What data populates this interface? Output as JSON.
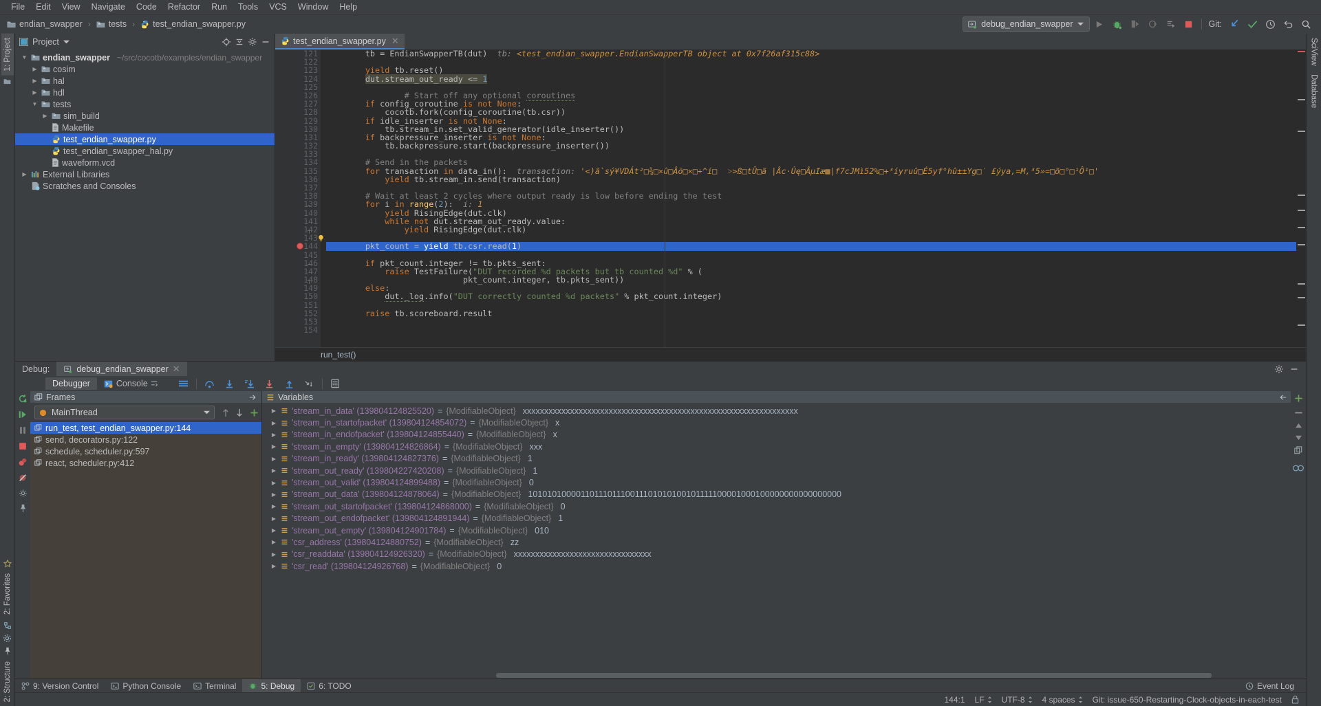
{
  "menu": {
    "items": [
      "File",
      "Edit",
      "View",
      "Navigate",
      "Code",
      "Refactor",
      "Run",
      "Tools",
      "VCS",
      "Window",
      "Help"
    ]
  },
  "breadcrumb": {
    "project": "endian_swapper",
    "folder": "tests",
    "file": "test_endian_swapper.py",
    "sep": "›"
  },
  "toolbar": {
    "run_config": "debug_endian_swapper",
    "git_label": "Git:",
    "icons": [
      "run-icon",
      "debug-icon",
      "coverage-icon",
      "profile-icon",
      "attach-icon",
      "stop-icon"
    ],
    "git_icons": [
      "update-project-icon",
      "commit-icon",
      "history-icon",
      "rollback-icon",
      "search-everywhere-icon"
    ]
  },
  "left_strip": {
    "project_tab": "1: Project",
    "favorites_tab": "2: Favorites",
    "structure_tab": "2: Structure"
  },
  "right_strip": {
    "sciview_tab": "SciView",
    "database_tab": "Database"
  },
  "project_panel": {
    "title": "Project",
    "tree": [
      {
        "depth": 0,
        "arrow": "▼",
        "icon": "folder-icon",
        "label": "endian_swapper",
        "bold": true,
        "path": "~/src/cocotb/examples/endian_swapper",
        "selected": false
      },
      {
        "depth": 1,
        "arrow": "▶",
        "icon": "folder-icon",
        "label": "cosim",
        "bold": false,
        "path": "",
        "selected": false
      },
      {
        "depth": 1,
        "arrow": "▶",
        "icon": "folder-icon",
        "label": "hal",
        "bold": false,
        "path": "",
        "selected": false
      },
      {
        "depth": 1,
        "arrow": "▶",
        "icon": "folder-icon",
        "label": "hdl",
        "bold": false,
        "path": "",
        "selected": false
      },
      {
        "depth": 1,
        "arrow": "▼",
        "icon": "folder-icon",
        "label": "tests",
        "bold": false,
        "path": "",
        "selected": false
      },
      {
        "depth": 2,
        "arrow": "▶",
        "icon": "folder-icon",
        "label": "sim_build",
        "bold": false,
        "path": "",
        "selected": false
      },
      {
        "depth": 2,
        "arrow": "",
        "icon": "file-icon",
        "label": "Makefile",
        "bold": false,
        "path": "",
        "selected": false
      },
      {
        "depth": 2,
        "arrow": "",
        "icon": "python-icon",
        "label": "test_endian_swapper.py",
        "bold": false,
        "path": "",
        "selected": true
      },
      {
        "depth": 2,
        "arrow": "",
        "icon": "python-icon",
        "label": "test_endian_swapper_hal.py",
        "bold": false,
        "path": "",
        "selected": false
      },
      {
        "depth": 2,
        "arrow": "",
        "icon": "file-icon",
        "label": "waveform.vcd",
        "bold": false,
        "path": "",
        "selected": false
      },
      {
        "depth": 0,
        "arrow": "▶",
        "icon": "library-icon",
        "label": "External Libraries",
        "bold": false,
        "path": "",
        "selected": false
      },
      {
        "depth": 0,
        "arrow": "",
        "icon": "scratch-icon",
        "label": "Scratches and Consoles",
        "bold": false,
        "path": "",
        "selected": false
      }
    ]
  },
  "editor": {
    "tab_label": "test_endian_swapper.py",
    "footer_breadcrumb": "run_test()",
    "first_line": 121,
    "breakpoint_line": 144,
    "highlight_line": 144,
    "bulb_line": 143,
    "lines": [
      {
        "n": 121,
        "html": "        tb = EndianSwapperTB(dut)<span class=\"hint\">  tb: </span><span class=\"hintval\">&lt;test_endian_swapper.EndianSwapperTB object at 0x7f26af315c88&gt;</span>"
      },
      {
        "n": 122,
        "html": ""
      },
      {
        "n": 123,
        "html": "        <span class=\"kw\">yield</span> tb.reset()"
      },
      {
        "n": 124,
        "html": "        <span class=\"hlbox\">dut.stream_out_ready &lt;= <span class=\"num\">1</span></span>"
      },
      {
        "n": 125,
        "html": ""
      },
      {
        "n": 126,
        "html": "        <span class=\"cmt\">        # Start off any optional <span class=\"squig\">coroutines</span></span>"
      },
      {
        "n": 127,
        "html": "        <span class=\"kw\">if</span> config_coroutine <span class=\"kw\">is not</span> <span class=\"kw\">None</span>:"
      },
      {
        "n": 128,
        "html": "            cocotb.fork(config_coroutine(tb.csr))"
      },
      {
        "n": 129,
        "html": "        <span class=\"kw\">if</span> idle_inserter <span class=\"kw\">is not</span> <span class=\"kw\">None</span>:"
      },
      {
        "n": 130,
        "html": "            tb.stream_in.set_valid_generator(idle_inserter())"
      },
      {
        "n": 131,
        "html": "        <span class=\"kw\">if</span> backpressure_inserter <span class=\"kw\">is not</span> <span class=\"kw\">None</span>:"
      },
      {
        "n": 132,
        "html": "            tb.backpressure.start(backpressure_inserter())"
      },
      {
        "n": 133,
        "html": ""
      },
      {
        "n": 134,
        "html": "        <span class=\"cmt\"># Send in the packets</span>"
      },
      {
        "n": 135,
        "html": "        <span class=\"kw\">for</span> transaction <span class=\"kw\">in</span> data_in():<span class=\"hint\">  transaction: </span><span class=\"hintval\">'&lt;)ã`sý¥VDÁt²□¾□×û□Âö□×□÷^í□  ˃&gt;ß□tÛ□ã |Âc·Úę□ÂµIæ▩|f7cJMì52%□+³íyruû□É5yf°hû±±Yg□˙ £ýya,=M,³5»=□õ□°□¹Ô¹□'</span>"
      },
      {
        "n": 136,
        "html": "            <span class=\"kw\">yield</span> tb.stream_in.send(transaction)"
      },
      {
        "n": 137,
        "html": ""
      },
      {
        "n": 138,
        "html": "        <span class=\"cmt\"># Wait at least 2 cycles where output ready is low before ending the test</span>"
      },
      {
        "n": 139,
        "html": "        <span class=\"kw\">for</span> i <span class=\"kw\">in</span> <span class=\"fn\">range</span>(<span class=\"num\">2</span>):<span class=\"hint\">  i: </span><span class=\"hintval\">1</span>"
      },
      {
        "n": 140,
        "html": "            <span class=\"kw\">yield</span> RisingEdge(dut.clk)"
      },
      {
        "n": 141,
        "html": "            <span class=\"kw\">while not</span> dut.stream_out_ready.value:"
      },
      {
        "n": 142,
        "html": "                <span class=\"kw\">yield</span> RisingEdge(dut.clk)"
      },
      {
        "n": 143,
        "html": ""
      },
      {
        "n": 144,
        "html": "        pkt_count = <span class=\"kw\">yield</span> tb.csr.read(<span class=\"num\">1</span>)"
      },
      {
        "n": 145,
        "html": ""
      },
      {
        "n": 146,
        "html": "        <span class=\"kw\">if</span> pkt_count.integer != tb.pkts_sent:"
      },
      {
        "n": 147,
        "html": "            <span class=\"kw\">raise</span> TestFailure(<span class=\"str\">\"DUT recorded %d packets but tb counted %d\"</span> % ("
      },
      {
        "n": 148,
        "html": "                            pkt_count.integer, tb.pkts_sent))"
      },
      {
        "n": 149,
        "html": "        <span class=\"kw\">else</span>:"
      },
      {
        "n": 150,
        "html": "            <span class=\"squig\">dut._log</span>.info(<span class=\"str\">\"DUT correctly counted %d packets\"</span> % pkt_count.integer)"
      },
      {
        "n": 151,
        "html": ""
      },
      {
        "n": 152,
        "html": "        <span class=\"kw\">raise</span> tb.scoreboard.result"
      },
      {
        "n": 153,
        "html": ""
      },
      {
        "n": 154,
        "html": ""
      }
    ]
  },
  "debug": {
    "label": "Debug:",
    "session": "debug_endian_swapper",
    "tabs": [
      {
        "label": "Debugger",
        "icon": "debugger-icon",
        "selected": true
      },
      {
        "label": "Console",
        "icon": "console-icon",
        "selected": false
      }
    ],
    "frames": {
      "title": "Frames",
      "thread": "MainThread",
      "list": [
        {
          "label": "run_test, test_endian_swapper.py:144",
          "selected": true
        },
        {
          "label": "send, decorators.py:122",
          "selected": false
        },
        {
          "label": "schedule, scheduler.py:597",
          "selected": false
        },
        {
          "label": "react, scheduler.py:412",
          "selected": false
        }
      ]
    },
    "variables": {
      "title": "Variables",
      "rows": [
        {
          "name": "'stream_in_data' (139804124825520)",
          "type": "{ModifiableObject}",
          "value": "xxxxxxxxxxxxxxxxxxxxxxxxxxxxxxxxxxxxxxxxxxxxxxxxxxxxxxxxxxxxxxxx"
        },
        {
          "name": "'stream_in_startofpacket' (139804124854072)",
          "type": "{ModifiableObject}",
          "value": "x"
        },
        {
          "name": "'stream_in_endofpacket' (139804124855440)",
          "type": "{ModifiableObject}",
          "value": "x"
        },
        {
          "name": "'stream_in_empty' (139804124826864)",
          "type": "{ModifiableObject}",
          "value": "xxx"
        },
        {
          "name": "'stream_in_ready' (139804124827376)",
          "type": "{ModifiableObject}",
          "value": "1"
        },
        {
          "name": "'stream_out_ready' (139804227420208)",
          "type": "{ModifiableObject}",
          "value": "1"
        },
        {
          "name": "'stream_out_valid' (139804124899488)",
          "type": "{ModifiableObject}",
          "value": "0"
        },
        {
          "name": "'stream_out_data' (139804124878064)",
          "type": "{ModifiableObject}",
          "value": "1010101000011011101110011101010100101111100001000100000000000000000"
        },
        {
          "name": "'stream_out_startofpacket' (139804124868000)",
          "type": "{ModifiableObject}",
          "value": "0"
        },
        {
          "name": "'stream_out_endofpacket' (139804124891944)",
          "type": "{ModifiableObject}",
          "value": "1"
        },
        {
          "name": "'stream_out_empty' (139804124901784)",
          "type": "{ModifiableObject}",
          "value": "010"
        },
        {
          "name": "'csr_address' (139804124880752)",
          "type": "{ModifiableObject}",
          "value": "zz"
        },
        {
          "name": "'csr_readdata' (139804124926320)",
          "type": "{ModifiableObject}",
          "value": "xxxxxxxxxxxxxxxxxxxxxxxxxxxxxxxx"
        },
        {
          "name": "'csr_read' (139804124926768)",
          "type": "{ModifiableObject}",
          "value": "0"
        }
      ]
    }
  },
  "bottom_bar": {
    "items": [
      {
        "label": "9: Version Control",
        "icon": "vcs-icon",
        "selected": false
      },
      {
        "label": "Python Console",
        "icon": "python-console-icon",
        "selected": false
      },
      {
        "label": "Terminal",
        "icon": "terminal-icon",
        "selected": false
      },
      {
        "label": "5: Debug",
        "icon": "debug-icon",
        "selected": true
      },
      {
        "label": "6: TODO",
        "icon": "todo-icon",
        "selected": false
      }
    ],
    "event_log": "Event Log"
  },
  "status_bar": {
    "caret": "144:1",
    "line_sep": "LF",
    "encoding": "UTF-8",
    "indent": "4 spaces",
    "branch": "Git: issue-650-Restarting-Clock-objects-in-each-test",
    "lock_icon": "lock-icon"
  },
  "colors": {
    "accent_blue": "#2f65ca",
    "tab_underline": "#4a88c7",
    "bg_panel": "#3c3f41",
    "bg_editor": "#2b2b2b",
    "breakpoint_red": "#db5c5c"
  }
}
